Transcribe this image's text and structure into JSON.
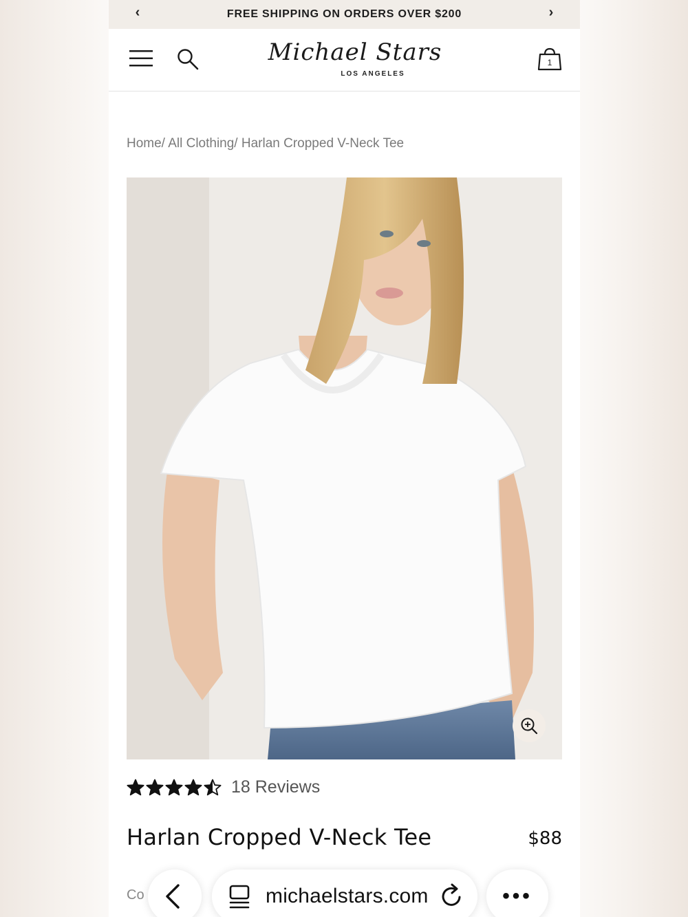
{
  "promo": {
    "text": "FREE SHIPPING ON ORDERS OVER $200",
    "prev": "‹",
    "next": "›"
  },
  "header": {
    "logo_script": "Michael Stars",
    "logo_sub": "LOS ANGELES",
    "cart_count": "1"
  },
  "breadcrumb": {
    "home": "Home/",
    "category": " All Clothing/",
    "current": " Harlan Cropped V-Neck Tee"
  },
  "product": {
    "rating": 4.5,
    "reviews": "18 Reviews",
    "title": "Harlan Cropped V-Neck Tee",
    "price": "$88",
    "partial_label": "Co"
  },
  "browser": {
    "url": "michaelstars.com",
    "more": "•••"
  },
  "colors": {
    "promo_bg": "#f1ede8",
    "zoom_bg": "#f3ede7",
    "text": "#111111",
    "muted": "#7a7a7a"
  }
}
